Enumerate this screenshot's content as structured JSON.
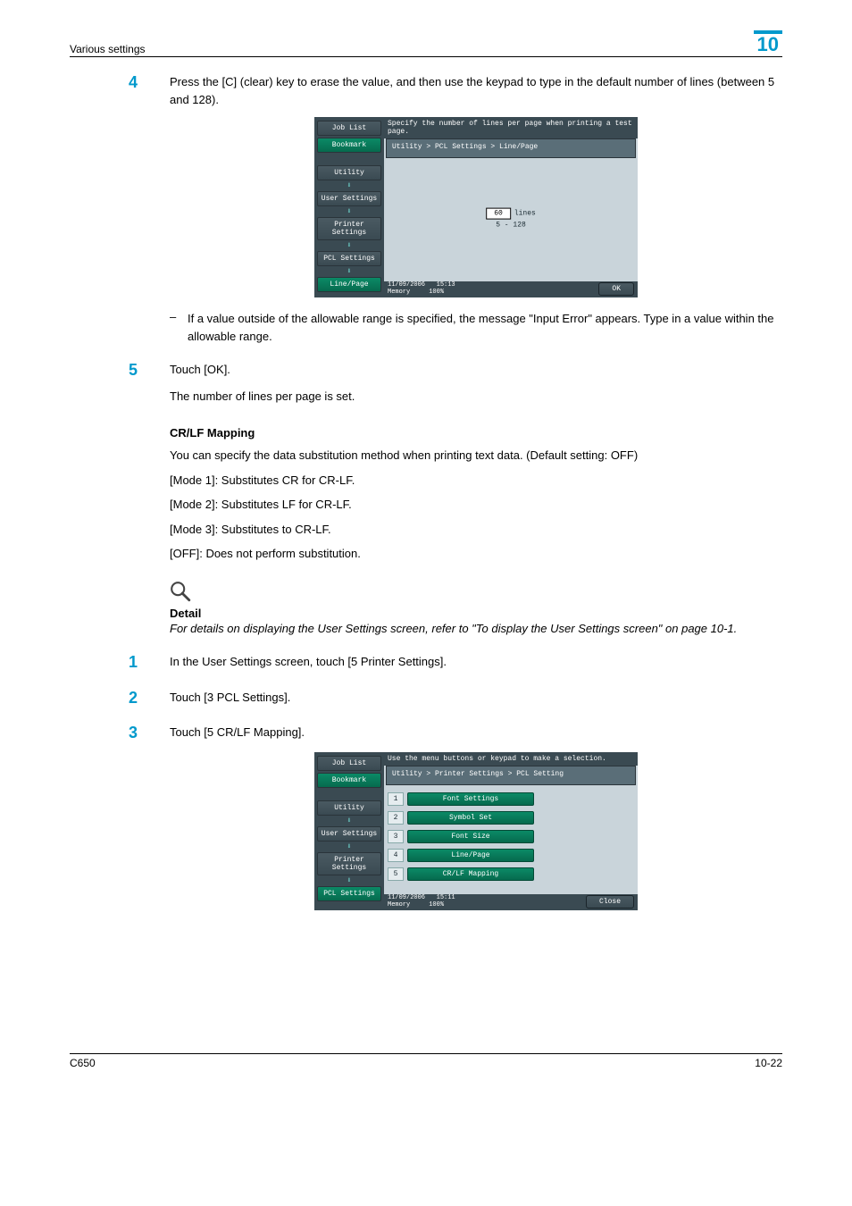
{
  "header": {
    "section_title": "Various settings",
    "chapter_num": "10"
  },
  "step4": {
    "num": "4",
    "text": "Press the [C] (clear) key to erase the value, and then use the keypad to type in the default number of lines (between 5 and 128).",
    "note_text": "If a value outside of the allowable range is specified, the message \"Input Error\" appears. Type in a value within the allowable range."
  },
  "screenshot1": {
    "side": {
      "job_list": "Job List",
      "bookmark": "Bookmark",
      "utility": "Utility",
      "user_settings": "User Settings",
      "printer_settings": "Printer Settings",
      "pcl_settings": "PCL Settings",
      "line_page": "Line/Page"
    },
    "topmsg": "Specify the number of lines per page when printing a test page.",
    "breadcrumb": "Utility > PCL Settings > Line/Page",
    "input_value": "60",
    "input_unit": "lines",
    "range": "5  -  128",
    "footer_date": "11/09/2006",
    "footer_time": "15:13",
    "footer_mem_label": "Memory",
    "footer_mem_val": "100%",
    "ok": "OK"
  },
  "step5": {
    "num": "5",
    "text": "Touch [OK].",
    "after": "The number of lines per page is set."
  },
  "crlf": {
    "heading": "CR/LF Mapping",
    "intro": "You can specify the data substitution method when printing text data. (Default setting: OFF)",
    "mode1": "[Mode 1]: Substitutes CR for CR-LF.",
    "mode2": "[Mode 2]: Substitutes LF for CR-LF.",
    "mode3": "[Mode 3]: Substitutes to CR-LF.",
    "off": "[OFF]: Does not perform substitution."
  },
  "detail": {
    "heading": "Detail",
    "text": "For details on displaying the User Settings screen, refer to \"To display the User Settings screen\" on page 10-1."
  },
  "step1b": {
    "num": "1",
    "text": "In the User Settings screen, touch [5 Printer Settings]."
  },
  "step2b": {
    "num": "2",
    "text": "Touch [3 PCL Settings]."
  },
  "step3b": {
    "num": "3",
    "text": "Touch [5 CR/LF Mapping]."
  },
  "screenshot2": {
    "side": {
      "job_list": "Job List",
      "bookmark": "Bookmark",
      "utility": "Utility",
      "user_settings": "User Settings",
      "printer_settings": "Printer Settings",
      "pcl_settings": "PCL Settings"
    },
    "topmsg": "Use the menu buttons or keypad to make a selection.",
    "breadcrumb": "Utility > Printer Settings > PCL Setting",
    "menu": [
      {
        "n": "1",
        "l": "Font Settings"
      },
      {
        "n": "2",
        "l": "Symbol Set"
      },
      {
        "n": "3",
        "l": "Font Size"
      },
      {
        "n": "4",
        "l": "Line/Page"
      },
      {
        "n": "5",
        "l": "CR/LF Mapping"
      }
    ],
    "footer_date": "11/09/2006",
    "footer_time": "15:11",
    "footer_mem_label": "Memory",
    "footer_mem_val": "100%",
    "close": "Close"
  },
  "footer": {
    "left": "C650",
    "right": "10-22"
  }
}
